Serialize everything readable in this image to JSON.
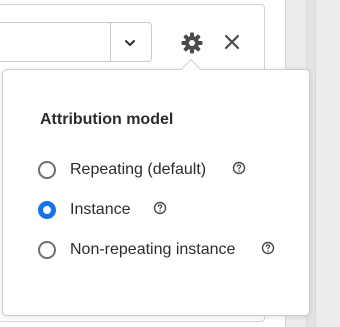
{
  "toolbar": {
    "icons": {
      "dropdown": "chevron-down-icon",
      "settings": "gear-icon",
      "close": "close-icon"
    }
  },
  "popover": {
    "title": "Attribution model",
    "options": [
      {
        "label": "Repeating (default)",
        "selected": false,
        "help_icon": "help-icon"
      },
      {
        "label": "Instance",
        "selected": true,
        "help_icon": "help-icon"
      },
      {
        "label": "Non-repeating instance",
        "selected": false,
        "help_icon": "help-icon"
      }
    ]
  },
  "colors": {
    "accent": "#1473e6",
    "text": "#2c2c2c",
    "icon": "#4b4b4b",
    "border": "#cfcfcf"
  }
}
